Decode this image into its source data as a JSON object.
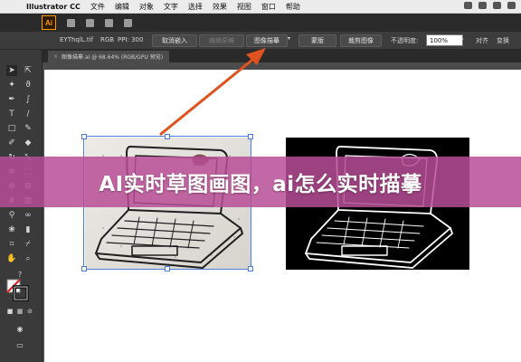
{
  "menubar": {
    "app_name": "Illustrator CC",
    "items": [
      "文件",
      "编辑",
      "对象",
      "文字",
      "选择",
      "效果",
      "视图",
      "窗口",
      "帮助"
    ]
  },
  "app": {
    "logo_text": "Ai",
    "accent": "#ff9a00"
  },
  "control_bar": {
    "filename": "EYThqlL.tif",
    "color_mode": "RGB",
    "ppi": "PPI: 300",
    "embed_button": "取消嵌入",
    "edit_original_button": "编辑原稿",
    "image_trace_button": "图像描摹",
    "mask_button": "蒙版",
    "crop_button": "裁剪图像",
    "opacity_label": "不透明度:",
    "opacity_value": "100%",
    "align_button": "对齐",
    "transform_button": "变换"
  },
  "document_tab": {
    "title": "图像描摹.ai @ 68.64% (RGB/GPU 预览)"
  },
  "banner": {
    "text": "AI实时草图画图，ai怎么实时描摹",
    "color": "#b94d96"
  },
  "colors": {
    "selection_blue": "#4a7ed8",
    "arrow_orange": "#e0521e"
  }
}
